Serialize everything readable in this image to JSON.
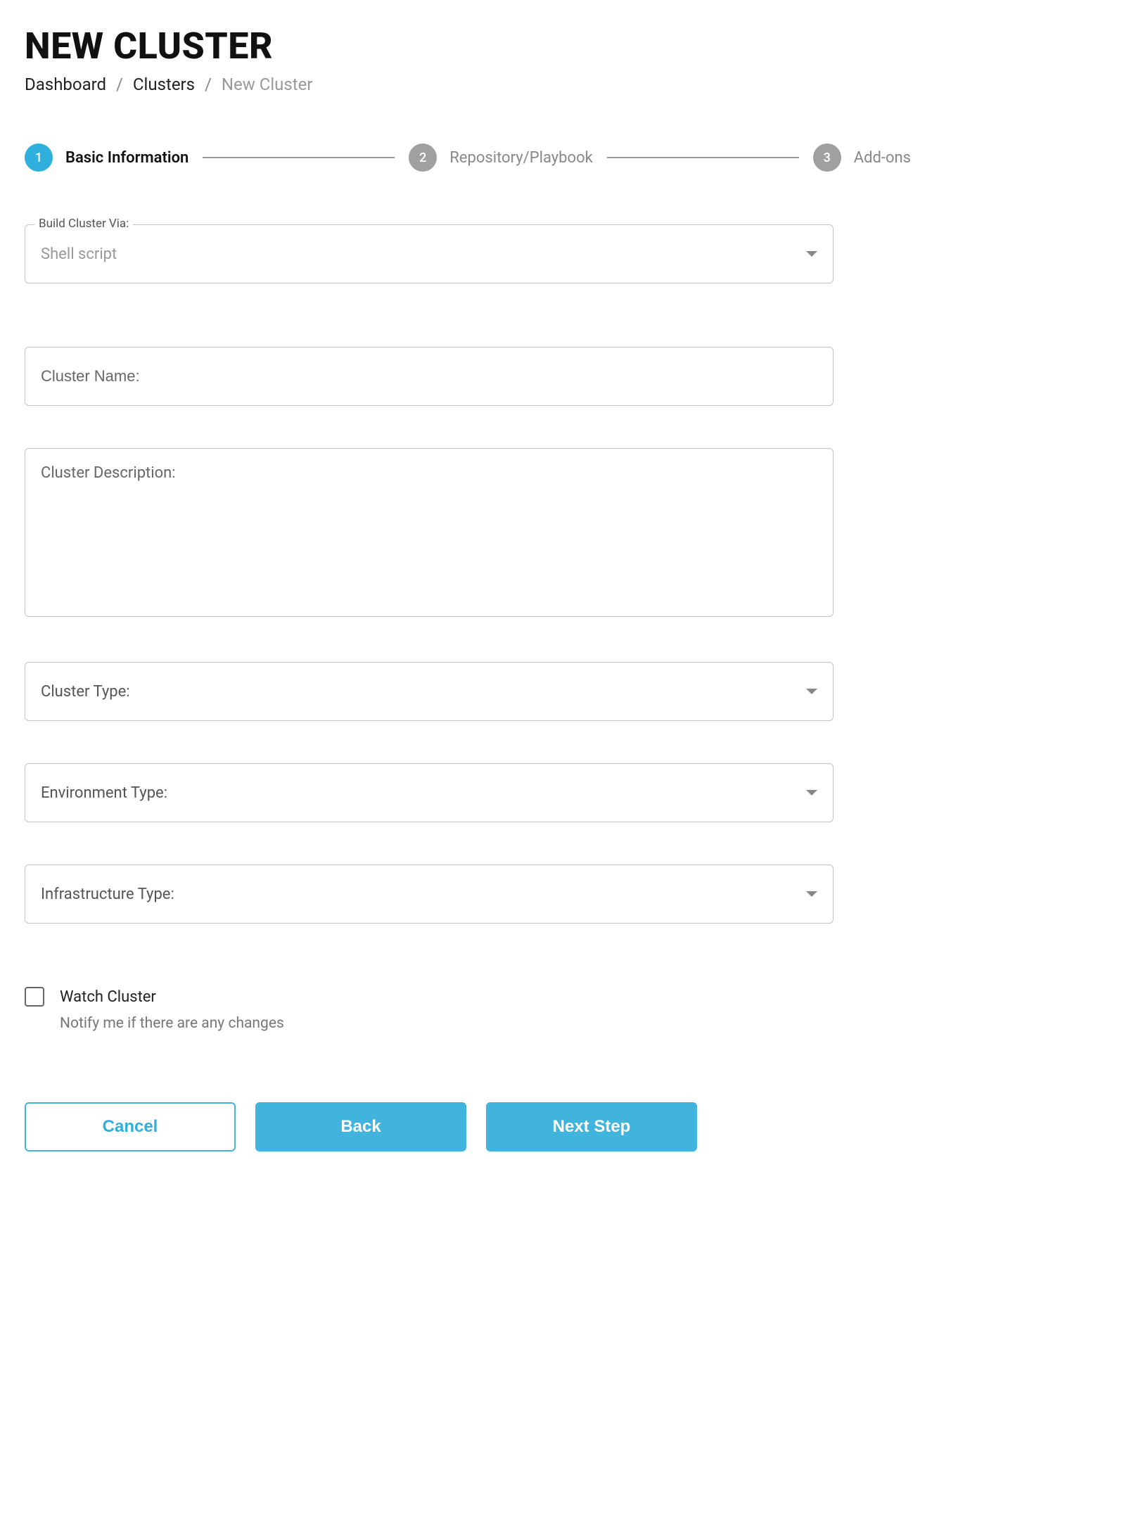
{
  "page": {
    "title": "NEW CLUSTER"
  },
  "breadcrumb": {
    "items": [
      {
        "label": "Dashboard"
      },
      {
        "label": "Clusters"
      }
    ],
    "current": "New Cluster",
    "separator": "/"
  },
  "stepper": {
    "steps": [
      {
        "num": "1",
        "label": "Basic Information",
        "active": true
      },
      {
        "num": "2",
        "label": "Repository/Playbook",
        "active": false
      },
      {
        "num": "3",
        "label": "Add-ons",
        "active": false
      }
    ]
  },
  "form": {
    "build_via": {
      "legend": "Build Cluster Via:",
      "value": "Shell script"
    },
    "cluster_name": {
      "placeholder": "Cluster Name:",
      "value": ""
    },
    "cluster_description": {
      "placeholder": "Cluster Description:",
      "value": ""
    },
    "cluster_type": {
      "label": "Cluster Type:",
      "value": ""
    },
    "environment_type": {
      "label": "Environment Type:",
      "value": ""
    },
    "infrastructure_type": {
      "label": "Infrastructure Type:",
      "value": ""
    },
    "watch_cluster": {
      "label": "Watch Cluster",
      "sublabel": "Notify me if there are any changes",
      "checked": false
    }
  },
  "buttons": {
    "cancel": "Cancel",
    "back": "Back",
    "next": "Next Step"
  }
}
